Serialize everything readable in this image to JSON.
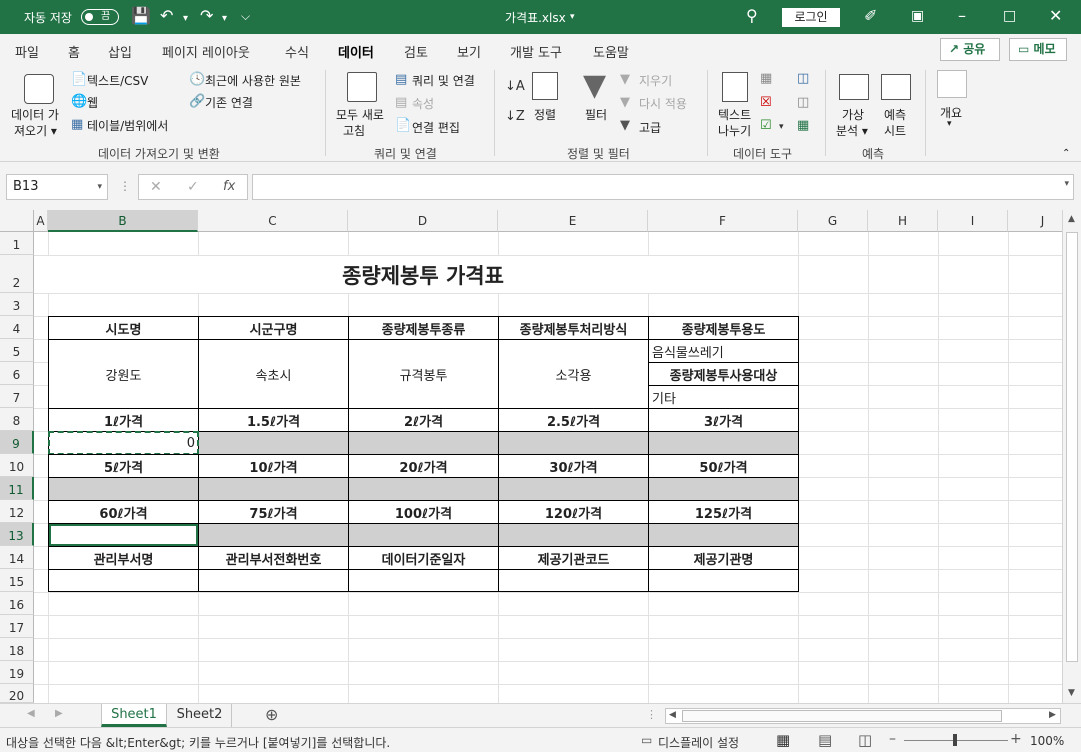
{
  "titlebar": {
    "autosave_label": "자동 저장",
    "autosave_state": "끔",
    "filename": "가격표.xlsx",
    "login_label": "로그인"
  },
  "ribbon_tabs": [
    "파일",
    "홈",
    "삽입",
    "페이지 레이아웃",
    "수식",
    "데이터",
    "검토",
    "보기",
    "개발 도구",
    "도움말"
  ],
  "active_tab": "데이터",
  "share_label": "공유",
  "memo_label": "메모",
  "ribbon": {
    "get_data": "데이터 가\n져오기",
    "text_csv": "텍스트/CSV",
    "web": "웹",
    "from_table": "테이블/범위에서",
    "recent_sources": "최근에 사용한 원본",
    "existing_conn": "기존 연결",
    "group_get": "데이터 가져오기 및 변환",
    "refresh_all_1": "모두 새로",
    "refresh_all_2": "고침",
    "queries_conn": "쿼리 및 연결",
    "properties": "속성",
    "edit_links": "연결 편집",
    "group_queries": "쿼리 및 연결",
    "sort": "정렬",
    "filter": "필터",
    "clear": "지우기",
    "reapply": "다시 적용",
    "advanced": "고급",
    "group_sort": "정렬 및 필터",
    "text_to_cols_1": "텍스트",
    "text_to_cols_2": "나누기",
    "group_tools": "데이터 도구",
    "whatif_1": "가상",
    "whatif_2": "분석",
    "forecast_1": "예측",
    "forecast_2": "시트",
    "group_forecast": "예측",
    "outline": "개요"
  },
  "namebox": "B13",
  "columns": [
    "A",
    "B",
    "C",
    "D",
    "E",
    "F",
    "G",
    "H",
    "I",
    "J"
  ],
  "rows": [
    "1",
    "2",
    "3",
    "4",
    "5",
    "6",
    "7",
    "8",
    "9",
    "10",
    "11",
    "12",
    "13",
    "14",
    "15",
    "16",
    "17",
    "18",
    "19",
    "20"
  ],
  "sheet": {
    "title": "종량제봉투 가격표",
    "h_sido": "시도명",
    "h_sigungu": "시군구명",
    "h_kind": "종량제봉투종류",
    "h_method": "종량제봉투처리방식",
    "h_use": "종량제봉투용도",
    "v_sido": "강원도",
    "v_sigungu": "속초시",
    "v_kind": "규격봉투",
    "v_method": "소각용",
    "v_use": "음식물쓰레기",
    "h_target": "종량제봉투사용대상",
    "v_target": "기타",
    "p1": "1ℓ가격",
    "p15": "1.5ℓ가격",
    "p2": "2ℓ가격",
    "p25": "2.5ℓ가격",
    "p3": "3ℓ가격",
    "b9": "0",
    "p5": "5ℓ가격",
    "p10": "10ℓ가격",
    "p20": "20ℓ가격",
    "p30": "30ℓ가격",
    "p50": "50ℓ가격",
    "p60": "60ℓ가격",
    "p75": "75ℓ가격",
    "p100": "100ℓ가격",
    "p120": "120ℓ가격",
    "p125": "125ℓ가격",
    "h_dept": "관리부서명",
    "h_phone": "관리부서전화번호",
    "h_date": "데이터기준일자",
    "h_code": "제공기관코드",
    "h_org": "제공기관명"
  },
  "sheet_tabs": [
    "Sheet1",
    "Sheet2"
  ],
  "active_sheet": "Sheet1",
  "status": {
    "message": "대상을 선택한 다음 &lt;Enter&gt; 키를 누르거나 [붙여넣기]를 선택합니다.",
    "display_settings": "디스플레이 설정",
    "zoom": "100%"
  }
}
